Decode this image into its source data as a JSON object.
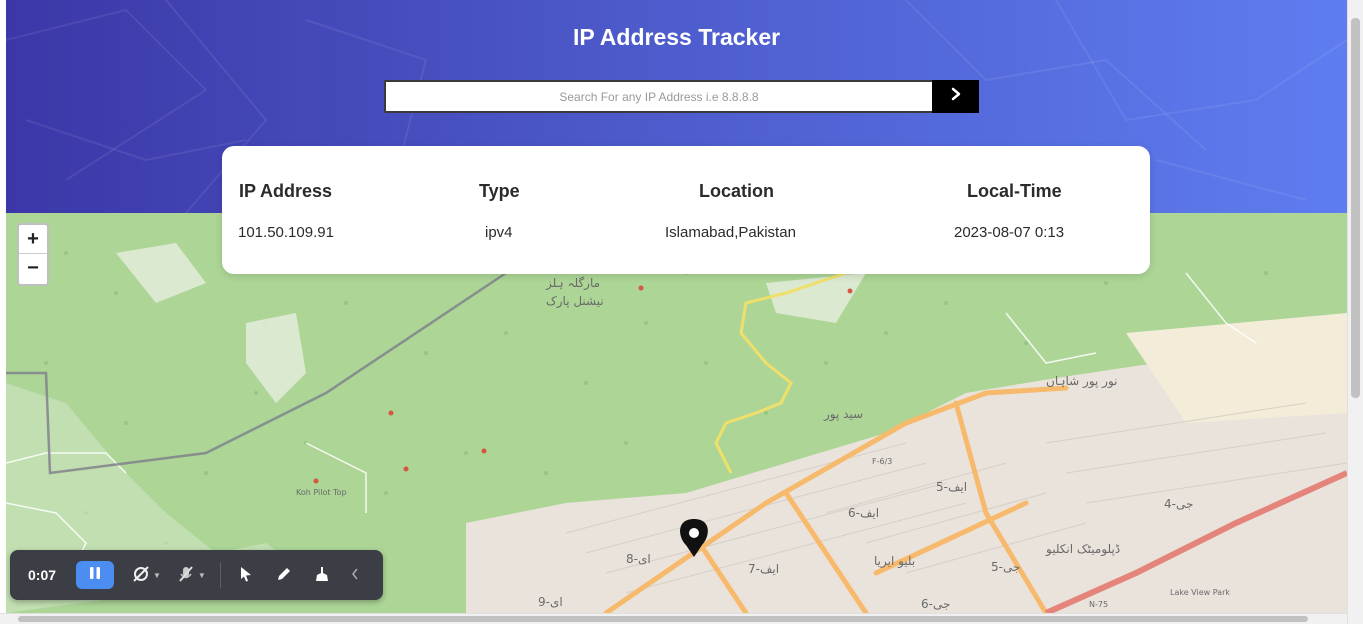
{
  "header": {
    "title": "IP Address Tracker"
  },
  "search": {
    "placeholder": "Search For any IP Address i.e 8.8.8.8",
    "value": "",
    "submit_icon": "chevron-right-icon"
  },
  "info": {
    "ip": {
      "label": "IP Address",
      "value": "101.50.109.91"
    },
    "type": {
      "label": "Type",
      "value": "ipv4"
    },
    "location": {
      "label": "Location",
      "value": "Islamabad,Pakistan"
    },
    "time": {
      "label": "Local-Time",
      "value": "2023-08-07 0:13"
    }
  },
  "map": {
    "zoom_in": "+",
    "zoom_out": "−",
    "marker_icon": "location-pin-icon",
    "labels": {
      "park": "مارگلہ ہلز",
      "park2": "نیشنل پارک",
      "saidpur": "سید پور",
      "noorpur": "نور پور شاہاں",
      "diplomatic": "ڈپلومیٹک انکلیو",
      "blue_area": "بلیو ایریا",
      "f6": "ایف-6",
      "f5": "ایف-5",
      "f7": "ایف-7",
      "e8": "ای-8",
      "g5": "جی-5",
      "g6": "جی-6",
      "g4": "جی-4",
      "e9": "ای-9",
      "f62": "F-6/3",
      "n75": "N-75",
      "kohpilot": "Koh Pilot Top",
      "lakeview": "Lake View Park"
    },
    "colors": {
      "forest": "#acd596",
      "urban": "#e9e3dc",
      "road_major": "#f7b96b",
      "road_trunk": "#e5847a",
      "trail": "#f0e06a",
      "boundary": "#7d7d8a"
    }
  },
  "recorder": {
    "elapsed": "0:07",
    "pause_icon": "pause-icon",
    "tools": [
      "camera-off-icon",
      "mic-off-icon",
      "pointer-icon",
      "pen-icon",
      "eraser-icon",
      "collapse-icon"
    ]
  }
}
